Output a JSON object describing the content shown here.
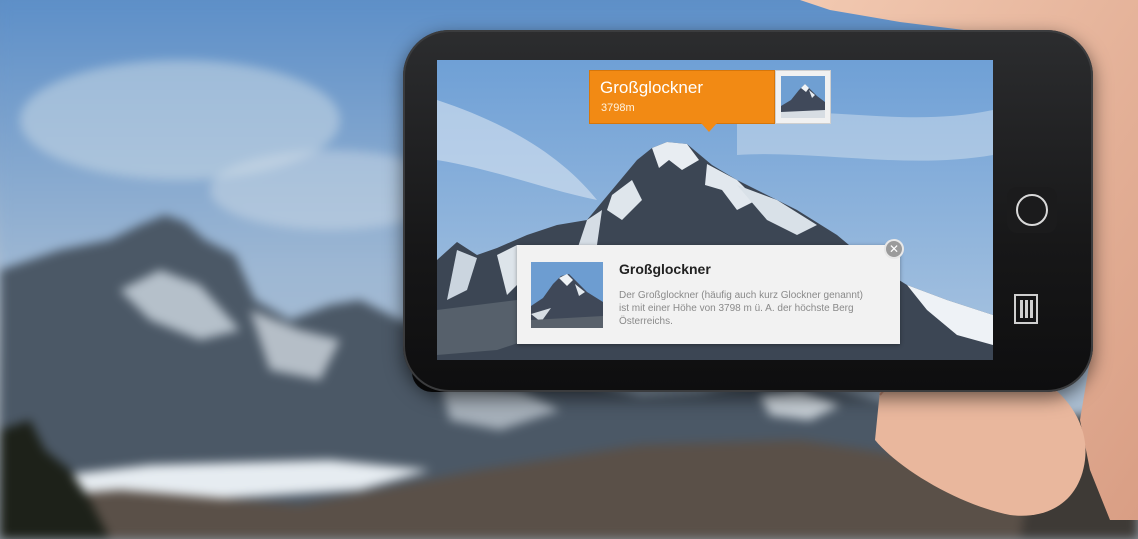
{
  "ar_label": {
    "name": "Großglockner",
    "altitude": "3798m"
  },
  "info_card": {
    "title": "Großglockner",
    "description": "Der Großglockner (häufig auch kurz Glockner genannt) ist mit einer Höhe von 3798 m ü. A. der höchste Berg Österreichs."
  },
  "icons": {
    "close": "close-icon",
    "home": "home-button-icon",
    "menu": "menu-icon"
  },
  "colors": {
    "label_orange": "#f28a14",
    "card_background": "#f2f2f2"
  }
}
